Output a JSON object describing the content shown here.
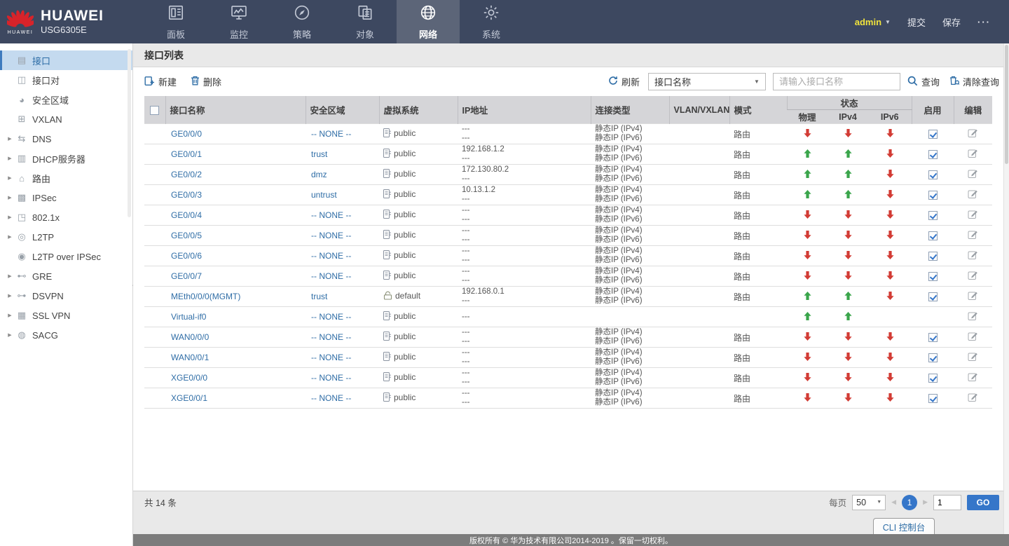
{
  "navbar": {
    "wordmark": "HUAWEI",
    "brand": "HUAWEI",
    "model": "USG6305E",
    "user": "admin",
    "commit_label": "提交",
    "save_label": "保存",
    "more_label": "···",
    "tabs": [
      {
        "label": "面板",
        "icon": "dashboard-icon",
        "selected": false
      },
      {
        "label": "监控",
        "icon": "monitor-icon",
        "selected": false
      },
      {
        "label": "策略",
        "icon": "policy-icon",
        "selected": false
      },
      {
        "label": "对象",
        "icon": "objects-icon",
        "selected": false
      },
      {
        "label": "网络",
        "icon": "network-icon",
        "selected": true
      },
      {
        "label": "系统",
        "icon": "system-icon",
        "selected": false
      }
    ]
  },
  "sidebar": {
    "items": [
      {
        "label": "接口",
        "icon": "interface-icon",
        "selected": true,
        "expandable": false
      },
      {
        "label": "接口对",
        "icon": "interface-pair-icon",
        "selected": false,
        "expandable": false
      },
      {
        "label": "安全区域",
        "icon": "security-zone-icon",
        "selected": false,
        "expandable": false
      },
      {
        "label": "VXLAN",
        "icon": "vxlan-icon",
        "selected": false,
        "expandable": false
      },
      {
        "label": "DNS",
        "icon": "dns-icon",
        "selected": false,
        "expandable": true
      },
      {
        "label": "DHCP服务器",
        "icon": "dhcp-server-icon",
        "selected": false,
        "expandable": true
      },
      {
        "label": "路由",
        "icon": "route-icon",
        "selected": false,
        "expandable": true
      },
      {
        "label": "IPSec",
        "icon": "ipsec-icon",
        "selected": false,
        "expandable": true
      },
      {
        "label": "802.1x",
        "icon": "dot1x-icon",
        "selected": false,
        "expandable": true
      },
      {
        "label": "L2TP",
        "icon": "l2tp-icon",
        "selected": false,
        "expandable": true
      },
      {
        "label": "L2TP over IPSec",
        "icon": "l2tp-ipsec-icon",
        "selected": false,
        "expandable": false
      },
      {
        "label": "GRE",
        "icon": "gre-icon",
        "selected": false,
        "expandable": true
      },
      {
        "label": "DSVPN",
        "icon": "dsvpn-icon",
        "selected": false,
        "expandable": true
      },
      {
        "label": "SSL VPN",
        "icon": "sslvpn-icon",
        "selected": false,
        "expandable": true
      },
      {
        "label": "SACG",
        "icon": "sacg-icon",
        "selected": false,
        "expandable": true
      }
    ]
  },
  "main": {
    "page_title": "接口列表",
    "toolbar": {
      "new_label": "新建",
      "delete_label": "删除",
      "refresh_label": "刷新",
      "filter_field": "接口名称",
      "search_placeholder": "请输入接口名称",
      "query_label": "查询",
      "clear_query_label": "清除查询"
    },
    "table": {
      "headers": {
        "name": "接口名称",
        "zone": "安全区域",
        "vsys": "虚拟系统",
        "ip": "IP地址",
        "conn": "连接类型",
        "vlan": "VLAN/VXLAN",
        "mode": "模式",
        "status": "状态",
        "phys": "物理",
        "ipv4": "IPv4",
        "ipv6": "IPv6",
        "enable": "启用",
        "edit": "编辑"
      },
      "rows": [
        {
          "name": "GE0/0/0",
          "zone": "-- NONE --",
          "vsys": "public",
          "vsys_icon": "vsys-public-icon",
          "ip": [
            "---",
            "---"
          ],
          "conn": [
            "静态IP (IPv4)",
            "静态IP (IPv6)"
          ],
          "vlan": "",
          "mode": "路由",
          "status": {
            "phys": "down",
            "ipv4": "down",
            "ipv6": "down"
          },
          "enabled": true
        },
        {
          "name": "GE0/0/1",
          "zone": "trust",
          "vsys": "public",
          "vsys_icon": "vsys-public-icon",
          "ip": [
            "192.168.1.2",
            "---"
          ],
          "conn": [
            "静态IP (IPv4)",
            "静态IP (IPv6)"
          ],
          "vlan": "",
          "mode": "路由",
          "status": {
            "phys": "up",
            "ipv4": "up",
            "ipv6": "down"
          },
          "enabled": true
        },
        {
          "name": "GE0/0/2",
          "zone": "dmz",
          "vsys": "public",
          "vsys_icon": "vsys-public-icon",
          "ip": [
            "172.130.80.2",
            "---"
          ],
          "conn": [
            "静态IP (IPv4)",
            "静态IP (IPv6)"
          ],
          "vlan": "",
          "mode": "路由",
          "status": {
            "phys": "up",
            "ipv4": "up",
            "ipv6": "down"
          },
          "enabled": true
        },
        {
          "name": "GE0/0/3",
          "zone": "untrust",
          "vsys": "public",
          "vsys_icon": "vsys-public-icon",
          "ip": [
            "10.13.1.2",
            "---"
          ],
          "conn": [
            "静态IP (IPv4)",
            "静态IP (IPv6)"
          ],
          "vlan": "",
          "mode": "路由",
          "status": {
            "phys": "up",
            "ipv4": "up",
            "ipv6": "down"
          },
          "enabled": true
        },
        {
          "name": "GE0/0/4",
          "zone": "-- NONE --",
          "vsys": "public",
          "vsys_icon": "vsys-public-icon",
          "ip": [
            "---",
            "---"
          ],
          "conn": [
            "静态IP (IPv4)",
            "静态IP (IPv6)"
          ],
          "vlan": "",
          "mode": "路由",
          "status": {
            "phys": "down",
            "ipv4": "down",
            "ipv6": "down"
          },
          "enabled": true
        },
        {
          "name": "GE0/0/5",
          "zone": "-- NONE --",
          "vsys": "public",
          "vsys_icon": "vsys-public-icon",
          "ip": [
            "---",
            "---"
          ],
          "conn": [
            "静态IP (IPv4)",
            "静态IP (IPv6)"
          ],
          "vlan": "",
          "mode": "路由",
          "status": {
            "phys": "down",
            "ipv4": "down",
            "ipv6": "down"
          },
          "enabled": true
        },
        {
          "name": "GE0/0/6",
          "zone": "-- NONE --",
          "vsys": "public",
          "vsys_icon": "vsys-public-icon",
          "ip": [
            "---",
            "---"
          ],
          "conn": [
            "静态IP (IPv4)",
            "静态IP (IPv6)"
          ],
          "vlan": "",
          "mode": "路由",
          "status": {
            "phys": "down",
            "ipv4": "down",
            "ipv6": "down"
          },
          "enabled": true
        },
        {
          "name": "GE0/0/7",
          "zone": "-- NONE --",
          "vsys": "public",
          "vsys_icon": "vsys-public-icon",
          "ip": [
            "---",
            "---"
          ],
          "conn": [
            "静态IP (IPv4)",
            "静态IP (IPv6)"
          ],
          "vlan": "",
          "mode": "路由",
          "status": {
            "phys": "down",
            "ipv4": "down",
            "ipv6": "down"
          },
          "enabled": true
        },
        {
          "name": "MEth0/0/0(MGMT)",
          "zone": "trust",
          "vsys": "default",
          "vsys_icon": "vsys-root-icon",
          "ip": [
            "192.168.0.1",
            "---"
          ],
          "conn": [
            "静态IP (IPv4)",
            "静态IP (IPv6)"
          ],
          "vlan": "",
          "mode": "路由",
          "status": {
            "phys": "up",
            "ipv4": "up",
            "ipv6": "down"
          },
          "enabled": true
        },
        {
          "name": "Virtual-if0",
          "zone": "-- NONE --",
          "vsys": "public",
          "vsys_icon": "vsys-public-icon",
          "ip": [
            "---"
          ],
          "conn": [],
          "vlan": "",
          "mode": "",
          "status": {
            "phys": "up",
            "ipv4": "up",
            "ipv6": ""
          },
          "enabled": null
        },
        {
          "name": "WAN0/0/0",
          "zone": "-- NONE --",
          "vsys": "public",
          "vsys_icon": "vsys-public-icon",
          "ip": [
            "---",
            "---"
          ],
          "conn": [
            "静态IP (IPv4)",
            "静态IP (IPv6)"
          ],
          "vlan": "",
          "mode": "路由",
          "status": {
            "phys": "down",
            "ipv4": "down",
            "ipv6": "down"
          },
          "enabled": true
        },
        {
          "name": "WAN0/0/1",
          "zone": "-- NONE --",
          "vsys": "public",
          "vsys_icon": "vsys-public-icon",
          "ip": [
            "---",
            "---"
          ],
          "conn": [
            "静态IP (IPv4)",
            "静态IP (IPv6)"
          ],
          "vlan": "",
          "mode": "路由",
          "status": {
            "phys": "down",
            "ipv4": "down",
            "ipv6": "down"
          },
          "enabled": true
        },
        {
          "name": "XGE0/0/0",
          "zone": "-- NONE --",
          "vsys": "public",
          "vsys_icon": "vsys-public-icon",
          "ip": [
            "---",
            "---"
          ],
          "conn": [
            "静态IP (IPv4)",
            "静态IP (IPv6)"
          ],
          "vlan": "",
          "mode": "路由",
          "status": {
            "phys": "down",
            "ipv4": "down",
            "ipv6": "down"
          },
          "enabled": true
        },
        {
          "name": "XGE0/0/1",
          "zone": "-- NONE --",
          "vsys": "public",
          "vsys_icon": "vsys-public-icon",
          "ip": [
            "---",
            "---"
          ],
          "conn": [
            "静态IP (IPv4)",
            "静态IP (IPv6)"
          ],
          "vlan": "",
          "mode": "路由",
          "status": {
            "phys": "down",
            "ipv4": "down",
            "ipv6": "down"
          },
          "enabled": true
        }
      ]
    },
    "pager": {
      "total": "共 14 条",
      "per_page_label": "每页",
      "per_page": "50",
      "page": "1",
      "goto": "1",
      "go_label": "GO"
    }
  },
  "bottom": {
    "cli_label": "CLI 控制台",
    "copyright": "版权所有 © 华为技术有限公司2014-2019 。保留一切权利。"
  },
  "colors": {
    "navbar_bg": "#3d4860",
    "navbar_active_bg": "#5c6578",
    "brand_red": "#d8232a",
    "link_blue": "#2f6da6",
    "accent_blue": "#3576c9",
    "green_up": "#3aa54b",
    "red_down": "#d23b34",
    "admin_yellow": "#f0e33c",
    "header_bg": "#d5d5d8",
    "main_bg": "#e9e9e9",
    "copyright_bg": "#7c7c7c",
    "sidebar_selected_bg": "#c4daef"
  }
}
